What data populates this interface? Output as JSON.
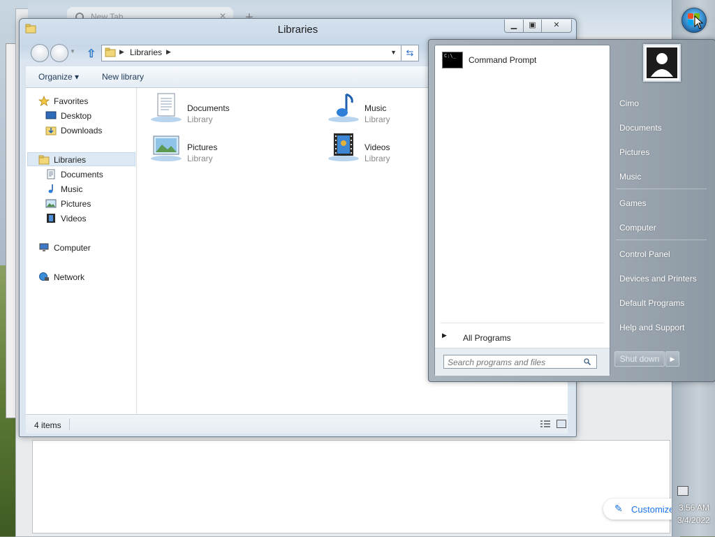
{
  "background": {
    "browser_tab_title": "New Tab",
    "browser_tab_close": "✕",
    "browser_new_tab": "+",
    "customize_label": "Customize"
  },
  "explorer": {
    "title": "Libraries",
    "address": {
      "path": "Libraries"
    },
    "toolbar": {
      "organize": "Organize ▾",
      "new_library": "New library"
    },
    "nav": {
      "favorites": "Favorites",
      "desktop": "Desktop",
      "downloads": "Downloads",
      "libraries": "Libraries",
      "documents": "Documents",
      "music": "Music",
      "pictures": "Pictures",
      "videos": "Videos",
      "computer": "Computer",
      "network": "Network"
    },
    "libraries": [
      {
        "name": "Documents",
        "type": "Library"
      },
      {
        "name": "Music",
        "type": "Library"
      },
      {
        "name": "Pictures",
        "type": "Library"
      },
      {
        "name": "Videos",
        "type": "Library"
      }
    ],
    "status": "4 items"
  },
  "start_menu": {
    "pinned_program": "Command Prompt",
    "all_programs": "All Programs",
    "search_placeholder": "Search programs and files",
    "right_items": [
      "Cimo",
      "Documents",
      "Pictures",
      "Music",
      "Games",
      "Computer",
      "Control Panel",
      "Devices and Printers",
      "Default Programs",
      "Help and Support"
    ],
    "shutdown": "Shut down"
  },
  "taskbar": {
    "time": "3:56 AM",
    "date": "3/4/2022"
  },
  "colors": {
    "selection": "#dde9f5",
    "accent": "#2c78c8",
    "start_menu_text": "#ffffff"
  }
}
